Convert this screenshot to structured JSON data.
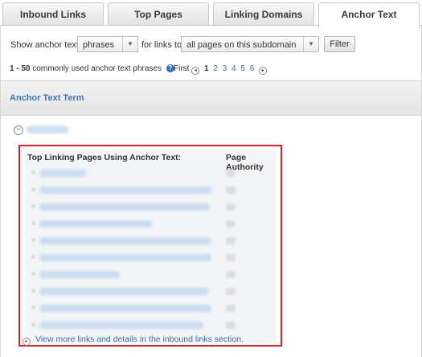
{
  "tabs": [
    {
      "label": "Inbound Links"
    },
    {
      "label": "Top Pages"
    },
    {
      "label": "Linking Domains"
    },
    {
      "label": "Anchor Text",
      "active": true
    }
  ],
  "controls": {
    "show_label": "Show anchor text",
    "anchor_type": "phrases",
    "for_links_label": "for links to",
    "scope": "all pages on this subdomain",
    "filter_label": "Filter"
  },
  "info": {
    "range": "1 - 50",
    "text": "commonly used anchor text phrases"
  },
  "pager": {
    "first_label": "First",
    "current": "1",
    "pages": [
      "2",
      "3",
      "4",
      "5",
      "6"
    ]
  },
  "section": {
    "header": "Anchor Text Term",
    "col_pages": "Top Linking Pages Using Anchor Text:",
    "col_authority": "Page Authority",
    "more_link": "View more links and details in the inbound links section."
  },
  "colors": {
    "link": "#2f6fb3",
    "highlight_border": "#d9232a"
  },
  "note": "anchor term, linking page URLs and authority values are blurred/obscured in the screenshot"
}
